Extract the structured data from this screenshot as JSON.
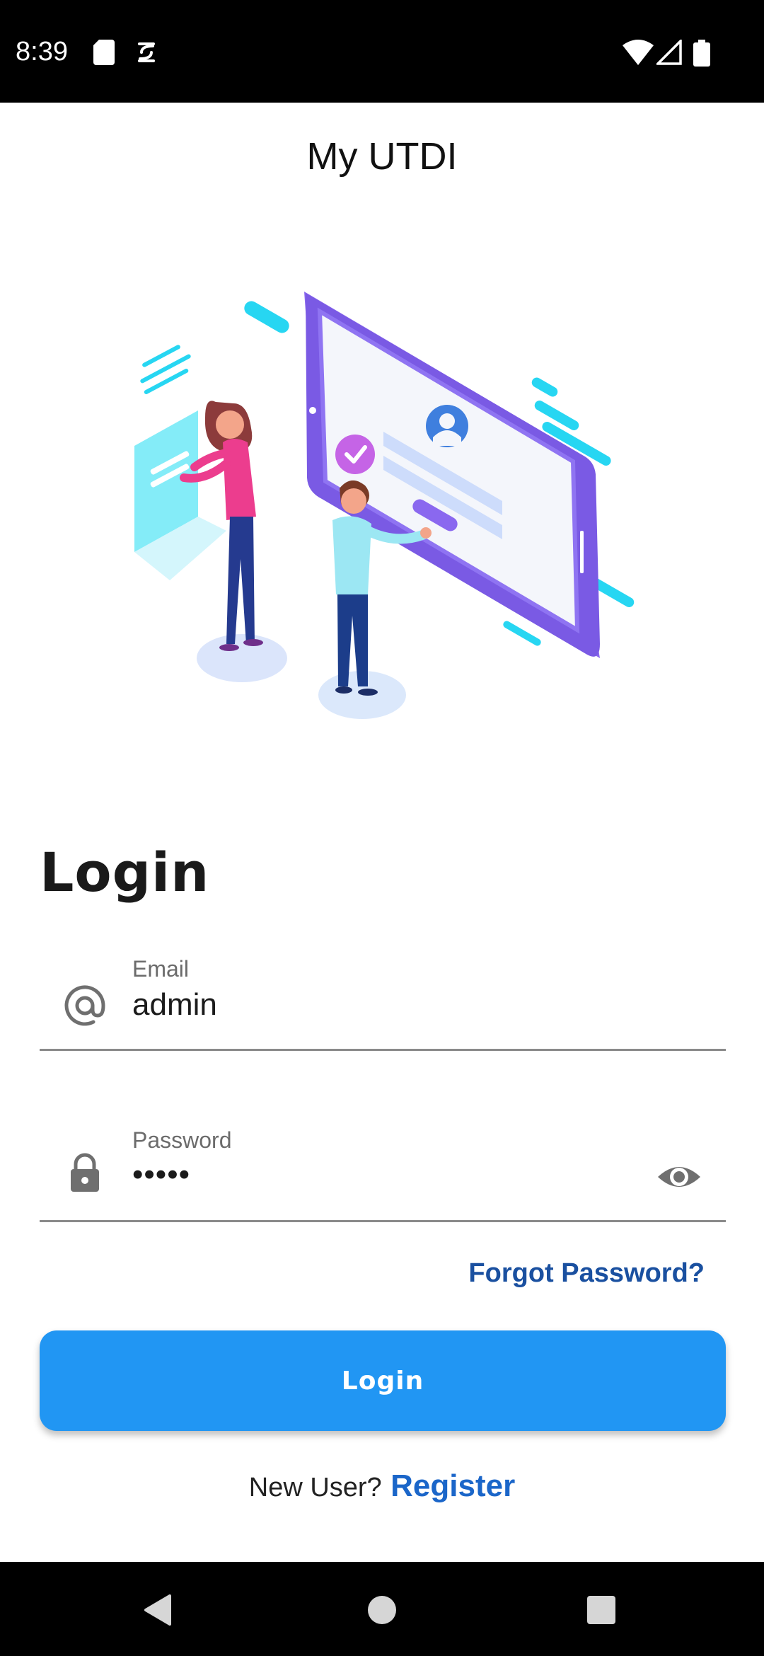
{
  "status_bar": {
    "time": "8:39"
  },
  "app_bar": {
    "title": "My UTDI"
  },
  "login": {
    "heading": "Login",
    "email_label": "Email",
    "email_value": "admin",
    "password_label": "Password",
    "password_value": "•••••",
    "forgot_password": "Forgot Password?",
    "button_label": "Login",
    "new_user_text": "New User?",
    "register_link": "Register"
  },
  "icons": {
    "email": "at-sign-icon",
    "password": "lock-icon",
    "visibility": "eye-icon",
    "back": "back-triangle-icon",
    "home": "home-circle-icon",
    "recents": "recents-square-icon"
  },
  "colors": {
    "primary": "#2196f3",
    "link": "#1b66c9",
    "forgot_link": "#1a50a0",
    "status_bar": "#000000"
  }
}
